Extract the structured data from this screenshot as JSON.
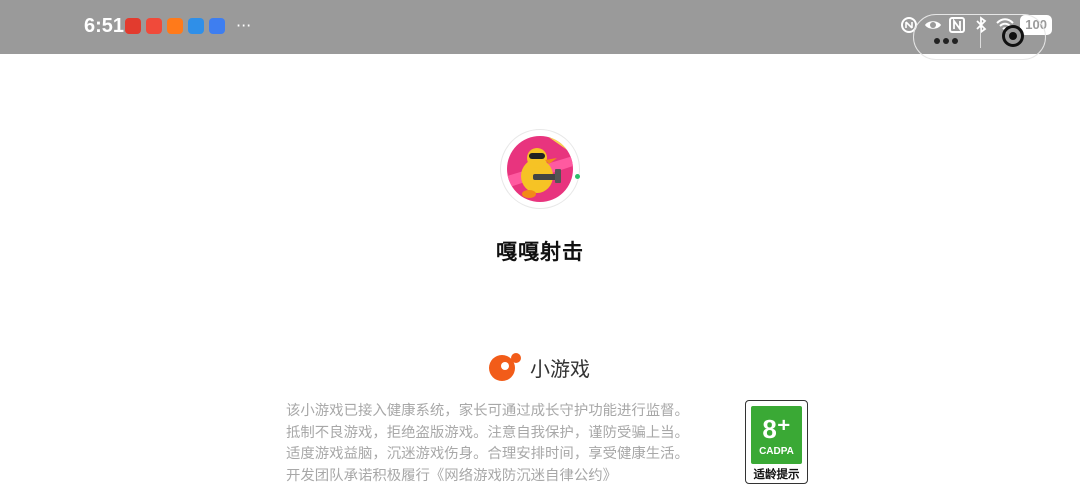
{
  "status_bar": {
    "time": "6:51",
    "notification_icons": [
      "app-notification-icon-red",
      "app-notification-icon-red-text",
      "app-notification-icon-orange",
      "app-notification-icon-blue-bird",
      "app-notification-icon-blue-camera"
    ],
    "overflow": "···",
    "battery": "100",
    "right_icons": [
      "nfc-icon",
      "eye-icon",
      "n-icon",
      "bluetooth-icon",
      "wifi-icon"
    ]
  },
  "capsule": {
    "menu_icon": "more-dots-icon",
    "close_icon": "close-circle-icon"
  },
  "game": {
    "title": "嘎嘎射击",
    "avatar_icon": "duck-shooter-avatar-icon"
  },
  "brand": {
    "label": "小游戏",
    "icon": "mini-game-logo-icon",
    "color": "#f25c19"
  },
  "notice": {
    "lines": [
      "该小游戏已接入健康系统，家长可通过成长守护功能进行监督。",
      "抵制不良游戏，拒绝盗版游戏。注意自我保护，谨防受骗上当。",
      "适度游戏益脑，沉迷游戏伤身。合理安排时间，享受健康生活。",
      "开发团队承诺积极履行《网络游戏防沉迷自律公约》"
    ]
  },
  "rating": {
    "age": "8⁺",
    "code": "CADPA",
    "tip": "适龄提示",
    "color": "#3aa935"
  }
}
